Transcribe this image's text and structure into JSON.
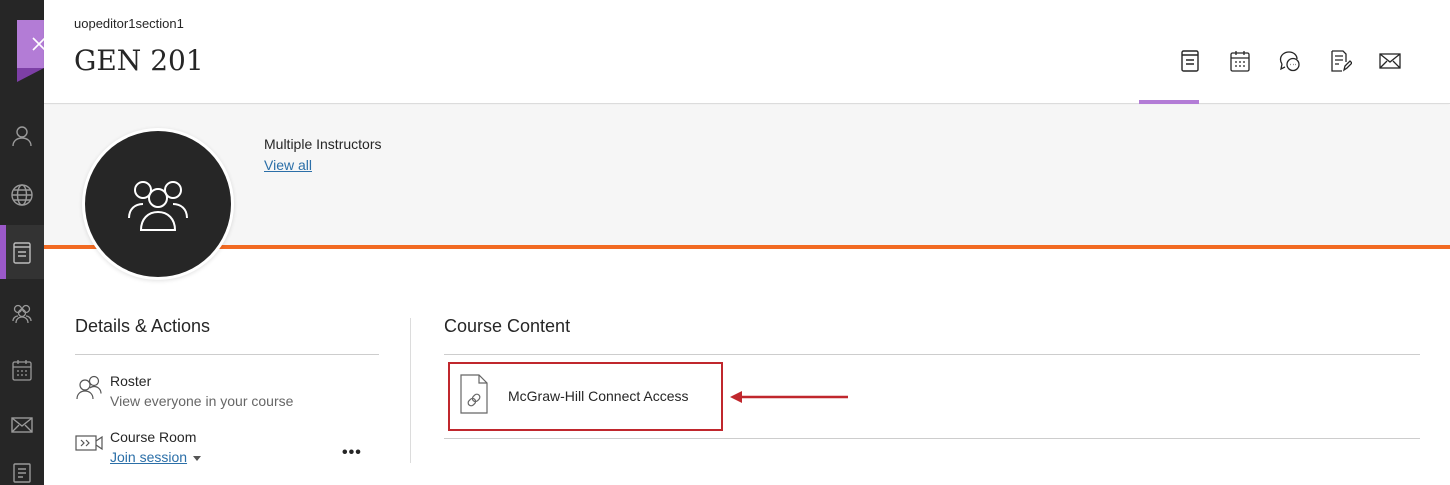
{
  "header": {
    "course_id": "uopeditor1section1",
    "course_title": "GEN 201",
    "nav_icons": [
      "course-content-icon",
      "calendar-icon",
      "discussions-icon",
      "gradebook-icon",
      "messages-icon"
    ]
  },
  "banner": {
    "instructors_label": "Multiple Instructors",
    "view_all": "View all"
  },
  "details": {
    "title": "Details & Actions",
    "roster": {
      "label": "Roster",
      "sub": "View everyone in your course"
    },
    "course_room": {
      "label": "Course Room",
      "link": "Join session"
    },
    "more": "•••"
  },
  "content": {
    "title": "Course Content",
    "items": [
      {
        "label": "McGraw-Hill Connect Access",
        "icon": "link-file-icon"
      }
    ]
  },
  "colors": {
    "accent_purple": "#b37cd6",
    "banner_orange": "#f26a22",
    "highlight_red": "#c0272d",
    "link_blue": "#2b6fa8",
    "rail_dark": "#262626"
  }
}
